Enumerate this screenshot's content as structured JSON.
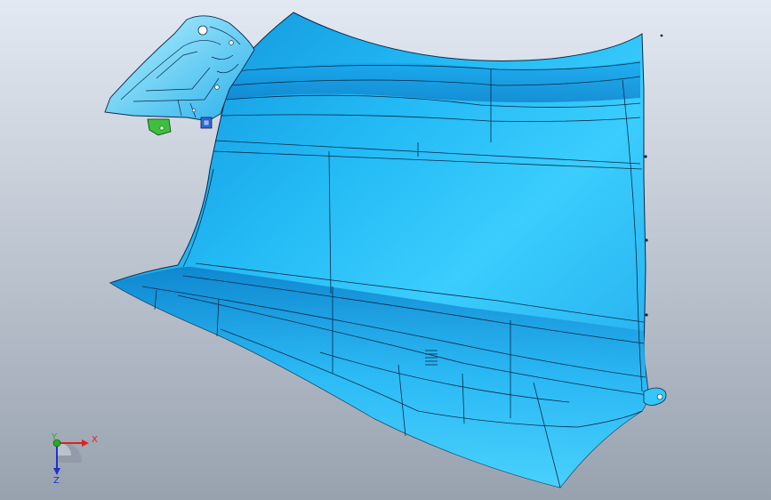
{
  "viewport": {
    "background_top": "#dfe6f0",
    "background_bottom": "#9aa4b1"
  },
  "model": {
    "fill_main": "#1fb6f2",
    "fill_light": "#3ad0ff",
    "fill_dark": "#0e86cf",
    "edge_color": "#0a2a4a",
    "bracket_fill": "#6fe0ff",
    "clip_green": "#3fbf3f",
    "clip_blue": "#2a6fe0"
  },
  "triad": {
    "x_label": "X",
    "y_label": "Y",
    "z_label": "Z",
    "x_color": "#e02020",
    "y_color": "#20b020",
    "z_color": "#2030d0"
  }
}
